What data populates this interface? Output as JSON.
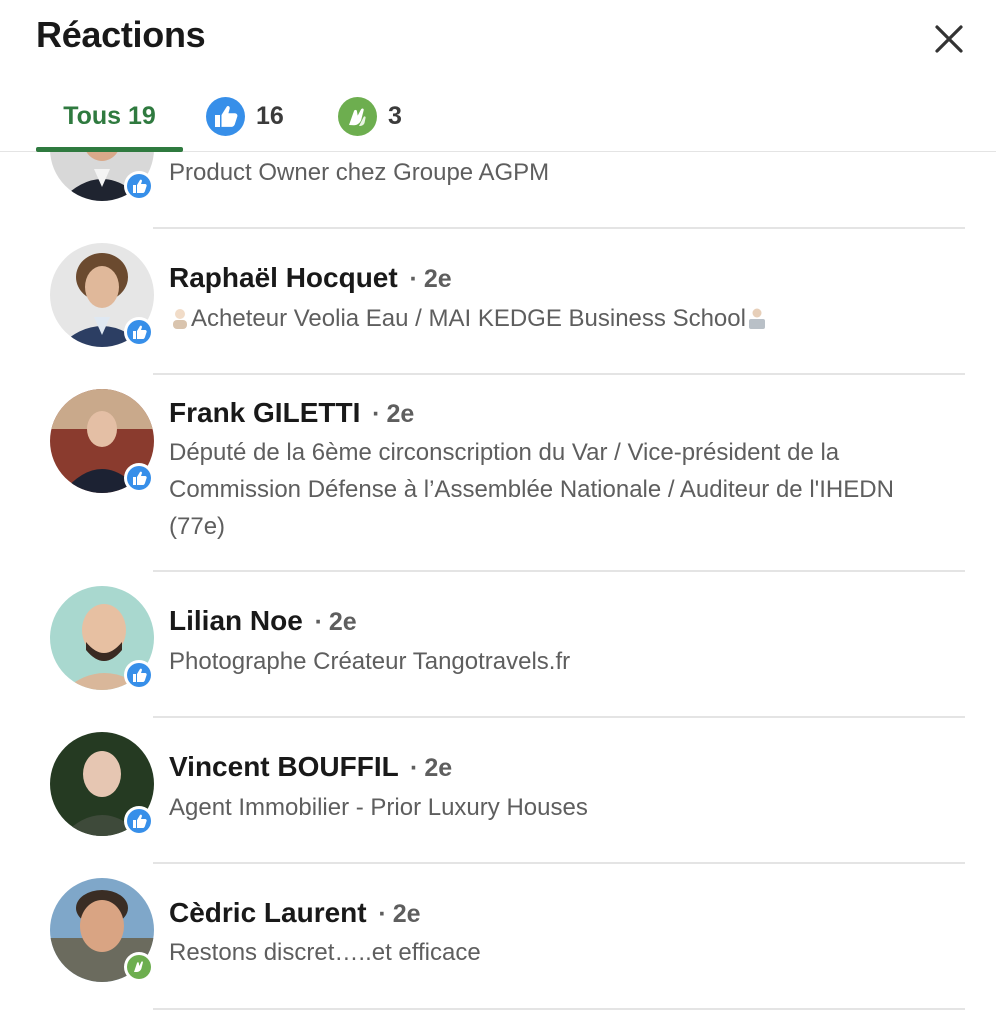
{
  "header": {
    "title": "Réactions"
  },
  "tabs": {
    "all": {
      "label": "Tous 19"
    },
    "like": {
      "count": "16",
      "icon": "like-icon",
      "color": "#378fe9"
    },
    "clap": {
      "count": "3",
      "icon": "celebrate-icon",
      "color": "#6dae4f"
    }
  },
  "accent_color": "#2f7a3f",
  "reactors": [
    {
      "name": "",
      "degree": "",
      "subtitle": "Product Owner chez Groupe AGPM",
      "reaction": "like"
    },
    {
      "name": "Raphaël Hocquet",
      "degree": "2e",
      "subtitle": "Acheteur Veolia Eau / MAI KEDGE Business School",
      "reaction": "like"
    },
    {
      "name": "Frank GILETTI",
      "degree": "2e",
      "subtitle": "Député de la 6ème circonscription du Var / Vice-président de la Commission Défense à l’Assemblée Nationale / Auditeur de l'IHEDN (77e)",
      "reaction": "like"
    },
    {
      "name": "Lilian Noe",
      "degree": "2e",
      "subtitle": "Photographe Créateur Tangotravels.fr",
      "reaction": "like"
    },
    {
      "name": "Vincent BOUFFIL",
      "degree": "2e",
      "subtitle": "Agent Immobilier - Prior Luxury Houses",
      "reaction": "like"
    },
    {
      "name": "Cèdric Laurent",
      "degree": "2e",
      "subtitle": "Restons discret…..et efficace",
      "reaction": "celebrate"
    }
  ]
}
